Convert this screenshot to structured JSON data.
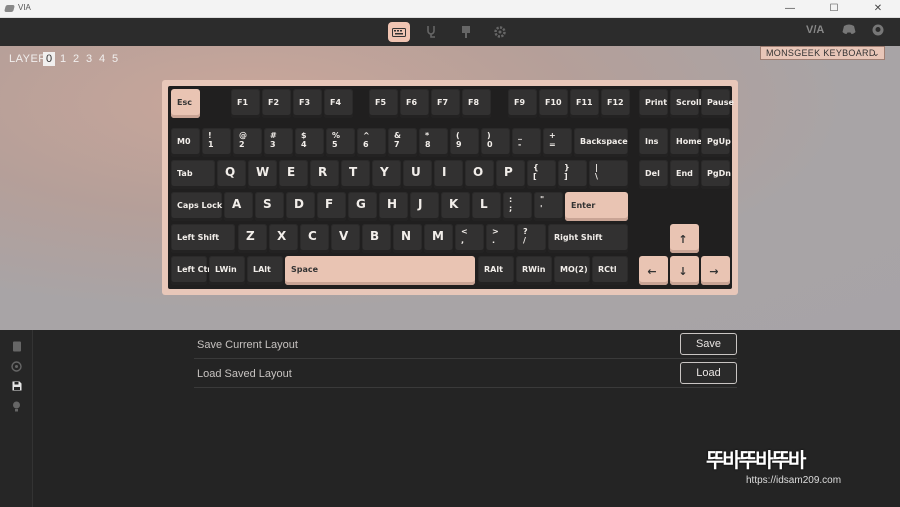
{
  "window": {
    "title": "VIA",
    "min": "—",
    "max": "☐",
    "close": "✕"
  },
  "toolbar": {
    "via_logo": "V/A",
    "icons": [
      "keyboard-icon",
      "test-icon",
      "design-icon",
      "settings-icon"
    ]
  },
  "layer": {
    "label": "LAYER",
    "items": [
      "0",
      "1",
      "2",
      "3",
      "4",
      "5"
    ],
    "selected": "0"
  },
  "keyboard_select": {
    "value": "MONSGEEK KEYBOARD",
    "chevron": "⌄"
  },
  "keys": {
    "esc": "Esc",
    "f1": "F1",
    "f2": "F2",
    "f3": "F3",
    "f4": "F4",
    "f5": "F5",
    "f6": "F6",
    "f7": "F7",
    "f8": "F8",
    "f9": "F9",
    "f10": "F10",
    "f11": "F11",
    "f12": "F12",
    "print": "Print",
    "scroll": "Scroll",
    "pause": "Pause",
    "m0": "M0",
    "n1t": "!",
    "n1b": "1",
    "n2t": "@",
    "n2b": "2",
    "n3t": "#",
    "n3b": "3",
    "n4t": "$",
    "n4b": "4",
    "n5t": "%",
    "n5b": "5",
    "n6t": "^",
    "n6b": "6",
    "n7t": "&",
    "n7b": "7",
    "n8t": "*",
    "n8b": "8",
    "n9t": "(",
    "n9b": "9",
    "n0t": ")",
    "n0b": "0",
    "mint": "_",
    "minb": "-",
    "eqt": "+",
    "eqb": "=",
    "backspace": "Backspace",
    "ins": "Ins",
    "home": "Home",
    "pgup": "PgUp",
    "tab": "Tab",
    "q": "Q",
    "w": "W",
    "e": "E",
    "r": "R",
    "t": "T",
    "y": "Y",
    "u": "U",
    "i": "I",
    "o": "O",
    "p": "P",
    "lbt": "{",
    "lbb": "[",
    "rbt": "}",
    "rbb": "]",
    "bst": "|",
    "bsb": "\\",
    "del": "Del",
    "end": "End",
    "pgdn": "PgDn",
    "caps": "Caps Lock",
    "a": "A",
    "s": "S",
    "d": "D",
    "f": "F",
    "g": "G",
    "h": "H",
    "j": "J",
    "k": "K",
    "l": "L",
    "sct": ":",
    "scb": ";",
    "qtt": "\"",
    "qtb": "'",
    "enter": "Enter",
    "lshift": "Left Shift",
    "z": "Z",
    "x": "X",
    "c": "C",
    "v": "V",
    "b": "B",
    "n": "N",
    "m": "M",
    "cmt": "<",
    "cmb": ",",
    "prt": ">",
    "prb": ".",
    "slt": "?",
    "slb": "/",
    "rshift": "Right Shift",
    "up": "↑",
    "lctrl": "Left Ctrl",
    "lwin": "LWin",
    "lalt": "LAlt",
    "space": "Space",
    "ralt": "RAlt",
    "rwin": "RWin",
    "mo2": "MO(2)",
    "rctl": "RCtl",
    "left": "←",
    "down": "↓",
    "right": "→"
  },
  "layout_actions": [
    {
      "label": "Save Current Layout",
      "button": "Save"
    },
    {
      "label": "Load Saved Layout",
      "button": "Load"
    }
  ],
  "watermark": {
    "logo": "뚜바뚜바뚜바",
    "url": "https://idsam209.com"
  }
}
